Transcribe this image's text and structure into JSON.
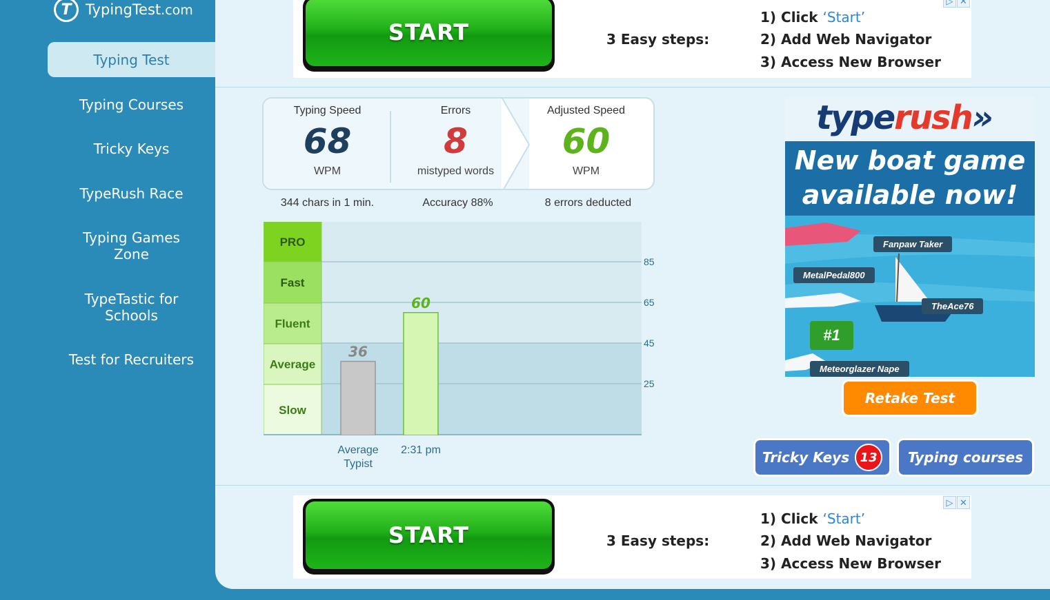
{
  "sidebar": {
    "logo_text": "TypingTest",
    "logo_domain": ".com",
    "items": [
      {
        "label": "Typing Test"
      },
      {
        "label": "Typing Courses"
      },
      {
        "label": "Tricky Keys"
      },
      {
        "label": "TypeRush Race"
      },
      {
        "label": "Typing Games Zone"
      },
      {
        "label": "TypeTastic for Schools"
      },
      {
        "label": "Test for Recruiters"
      }
    ]
  },
  "ad": {
    "start_label": "START",
    "easy_steps": "3 Easy steps:",
    "step1_prefix": "1) Click ",
    "step1_highlight": "‘Start’",
    "step2": "2) Add Web Navigator",
    "step3": "3) Access New Browser"
  },
  "stats": {
    "speed": {
      "label": "Typing Speed",
      "value": "68",
      "unit": "WPM",
      "sub": "344 chars in 1 min."
    },
    "errors": {
      "label": "Errors",
      "value": "8",
      "unit": "mistyped words",
      "sub": "Accuracy 88%"
    },
    "adjusted": {
      "label": "Adjusted Speed",
      "value": "60",
      "unit": "WPM",
      "sub": "8 errors deducted"
    }
  },
  "colors": {
    "speed": "#1f3f5f",
    "errors": "#d23b3b",
    "adjusted": "#5cb31c",
    "retake": "#ff8a00",
    "link_buttons": "#4a78c6"
  },
  "chart_data": {
    "type": "bar",
    "levels": [
      "PRO",
      "Fast",
      "Fluent",
      "Average",
      "Slow"
    ],
    "level_colors": [
      "#7ed321",
      "#9be061",
      "#b9ec8d",
      "#d8f6bd",
      "#ecfbdf"
    ],
    "yticks": [
      85,
      65,
      45,
      25
    ],
    "categories": [
      "Average Typist",
      "2:31 pm"
    ],
    "values": [
      36,
      60
    ],
    "value_labels": [
      "36",
      "60"
    ],
    "bar_colors": [
      "#c8c8c8",
      "#d6f6b4"
    ],
    "label_colors": [
      "#888888",
      "#5cb31c"
    ]
  },
  "promo": {
    "brand_a": "type",
    "brand_b": "rush",
    "headline1": "New boat game",
    "headline2": "available now!",
    "players": [
      "Fanpaw Taker",
      "MetalPedal800",
      "TheAce76",
      "Meteorglazer Nape"
    ],
    "rank": "#1"
  },
  "buttons": {
    "retake": "Retake Test",
    "tricky": "Tricky Keys",
    "tricky_count": "13",
    "courses": "Typing courses"
  }
}
